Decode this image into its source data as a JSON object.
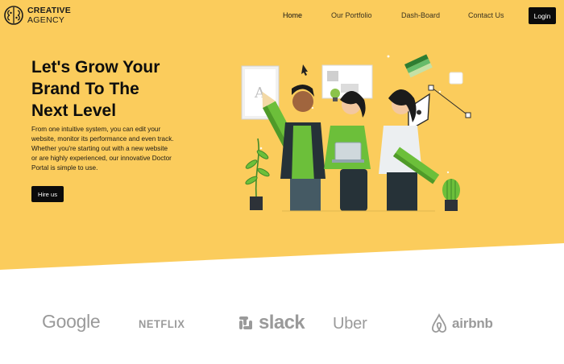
{
  "brand": {
    "name_line1": "CREATIVE",
    "name_line2": "AGENCY"
  },
  "nav": {
    "items": [
      {
        "label": "Home",
        "active": true
      },
      {
        "label": "Our Portfolio"
      },
      {
        "label": "Dash-Board"
      },
      {
        "label": "Contact Us"
      }
    ],
    "login_label": "Login"
  },
  "hero": {
    "title_lines": [
      "Let's Grow Your",
      "Brand To The",
      "Next Level"
    ],
    "description_lines": [
      "From one intuitive system, you can edit your",
      "website, monitor its performance and even track.",
      "Whether you're starting out with a new website",
      "or are highly experienced, our innovative Doctor",
      "Portal is simple to use."
    ],
    "cta_label": "Hire us",
    "illustration_letter": "A"
  },
  "partners": [
    "Google",
    "NETFLIX",
    "slack",
    "Uber",
    "airbnb"
  ],
  "colors": {
    "hero_bg": "#FBCC5C",
    "accent_green": "#6CBF3A",
    "dark": "#0B0B0B",
    "brand_gray": "#9A9A9A"
  }
}
